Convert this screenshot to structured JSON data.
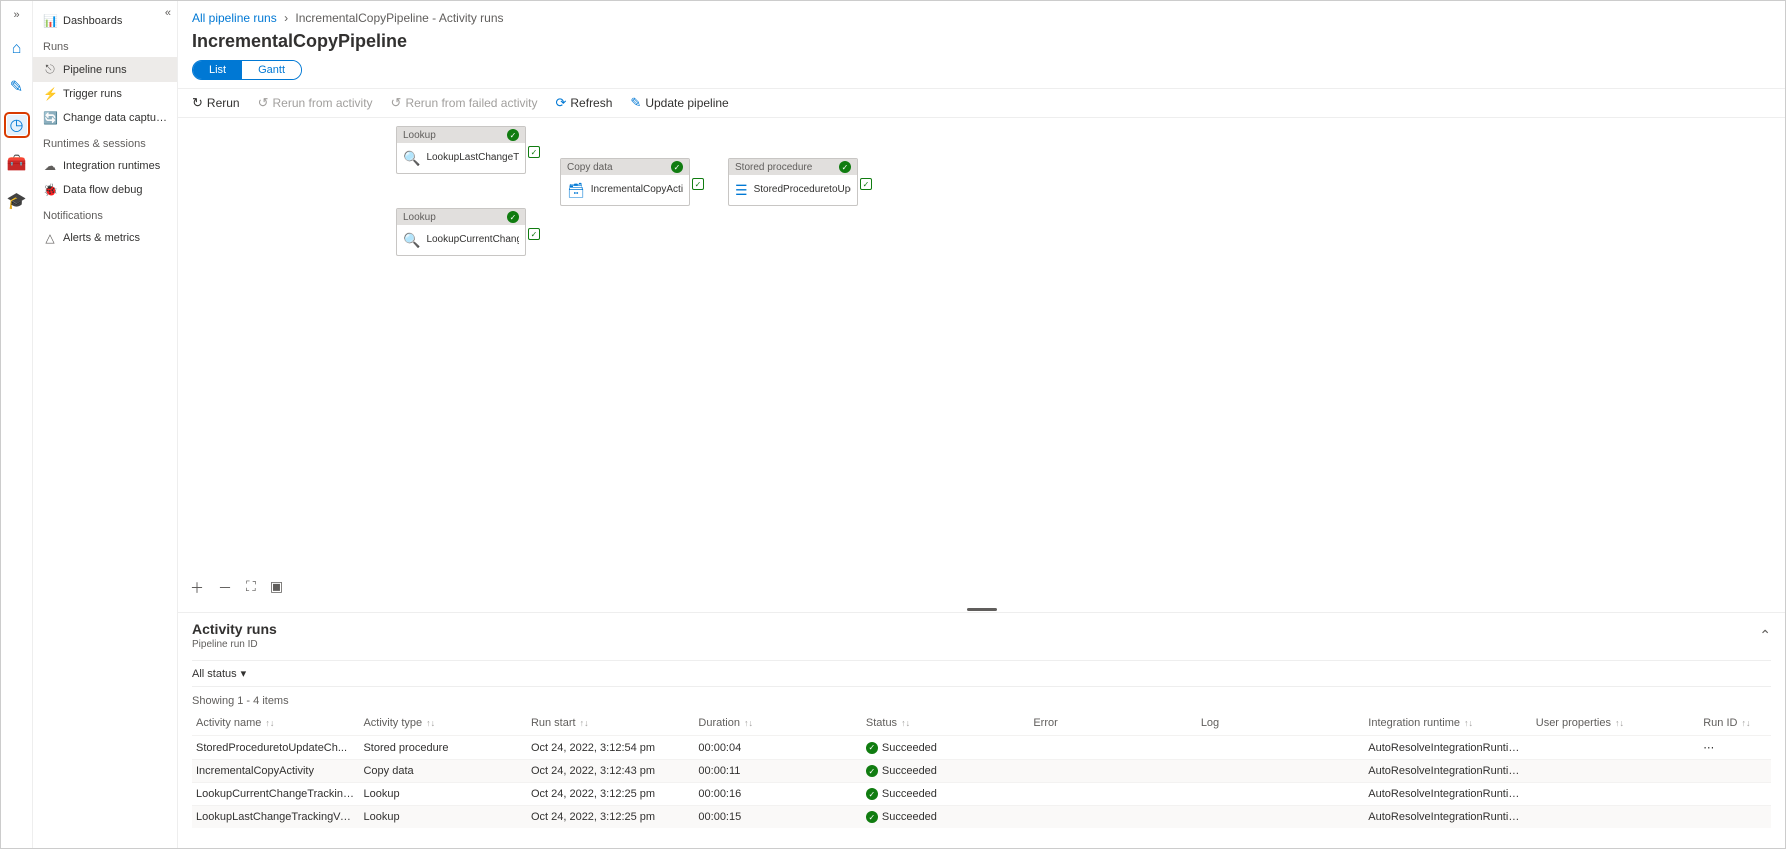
{
  "breadcrumb": {
    "link1": "All pipeline runs",
    "current": "IncrementalCopyPipeline - Activity runs"
  },
  "page_title": "IncrementalCopyPipeline",
  "view_toggle": {
    "list": "List",
    "gantt": "Gantt"
  },
  "toolbar": {
    "rerun": "Rerun",
    "rerun_activity": "Rerun from activity",
    "rerun_failed": "Rerun from failed activity",
    "refresh": "Refresh",
    "update": "Update pipeline"
  },
  "sidebar": {
    "dashboards": "Dashboards",
    "runs_header": "Runs",
    "pipeline_runs": "Pipeline runs",
    "trigger_runs": "Trigger runs",
    "cdc": "Change data capture (previ...",
    "runtimes_header": "Runtimes & sessions",
    "integration_runtimes": "Integration runtimes",
    "data_flow_debug": "Data flow debug",
    "notifications_header": "Notifications",
    "alerts_metrics": "Alerts & metrics"
  },
  "nodes": {
    "lookup1_type": "Lookup",
    "lookup1_name": "LookupLastChangeTrackingVersionAc...",
    "lookup2_type": "Lookup",
    "lookup2_name": "LookupCurrentChangeTrackingVersio...",
    "copy_type": "Copy data",
    "copy_name": "IncrementalCopyActivity",
    "sp_type": "Stored procedure",
    "sp_name": "StoredProceduretoUpdateChangeTra..."
  },
  "activity_panel": {
    "title": "Activity runs",
    "sub": "Pipeline run ID",
    "filter": "All status",
    "count": "Showing 1 - 4 items"
  },
  "columns": {
    "activity_name": "Activity name",
    "activity_type": "Activity type",
    "run_start": "Run start",
    "duration": "Duration",
    "status": "Status",
    "error": "Error",
    "log": "Log",
    "integration_runtime": "Integration runtime",
    "user_properties": "User properties",
    "run_id": "Run ID"
  },
  "rows": [
    {
      "name": "StoredProceduretoUpdateCh...",
      "type": "Stored procedure",
      "start": "Oct 24, 2022, 3:12:54 pm",
      "duration": "00:00:04",
      "status": "Succeeded",
      "ir": "AutoResolveIntegrationRuntime (N"
    },
    {
      "name": "IncrementalCopyActivity",
      "type": "Copy data",
      "start": "Oct 24, 2022, 3:12:43 pm",
      "duration": "00:00:11",
      "status": "Succeeded",
      "ir": "AutoResolveIntegrationRuntime (N"
    },
    {
      "name": "LookupCurrentChangeTracking...",
      "type": "Lookup",
      "start": "Oct 24, 2022, 3:12:25 pm",
      "duration": "00:00:16",
      "status": "Succeeded",
      "ir": "AutoResolveIntegrationRuntime (N"
    },
    {
      "name": "LookupLastChangeTrackingVer...",
      "type": "Lookup",
      "start": "Oct 24, 2022, 3:12:25 pm",
      "duration": "00:00:15",
      "status": "Succeeded",
      "ir": "AutoResolveIntegrationRuntime (N"
    }
  ]
}
